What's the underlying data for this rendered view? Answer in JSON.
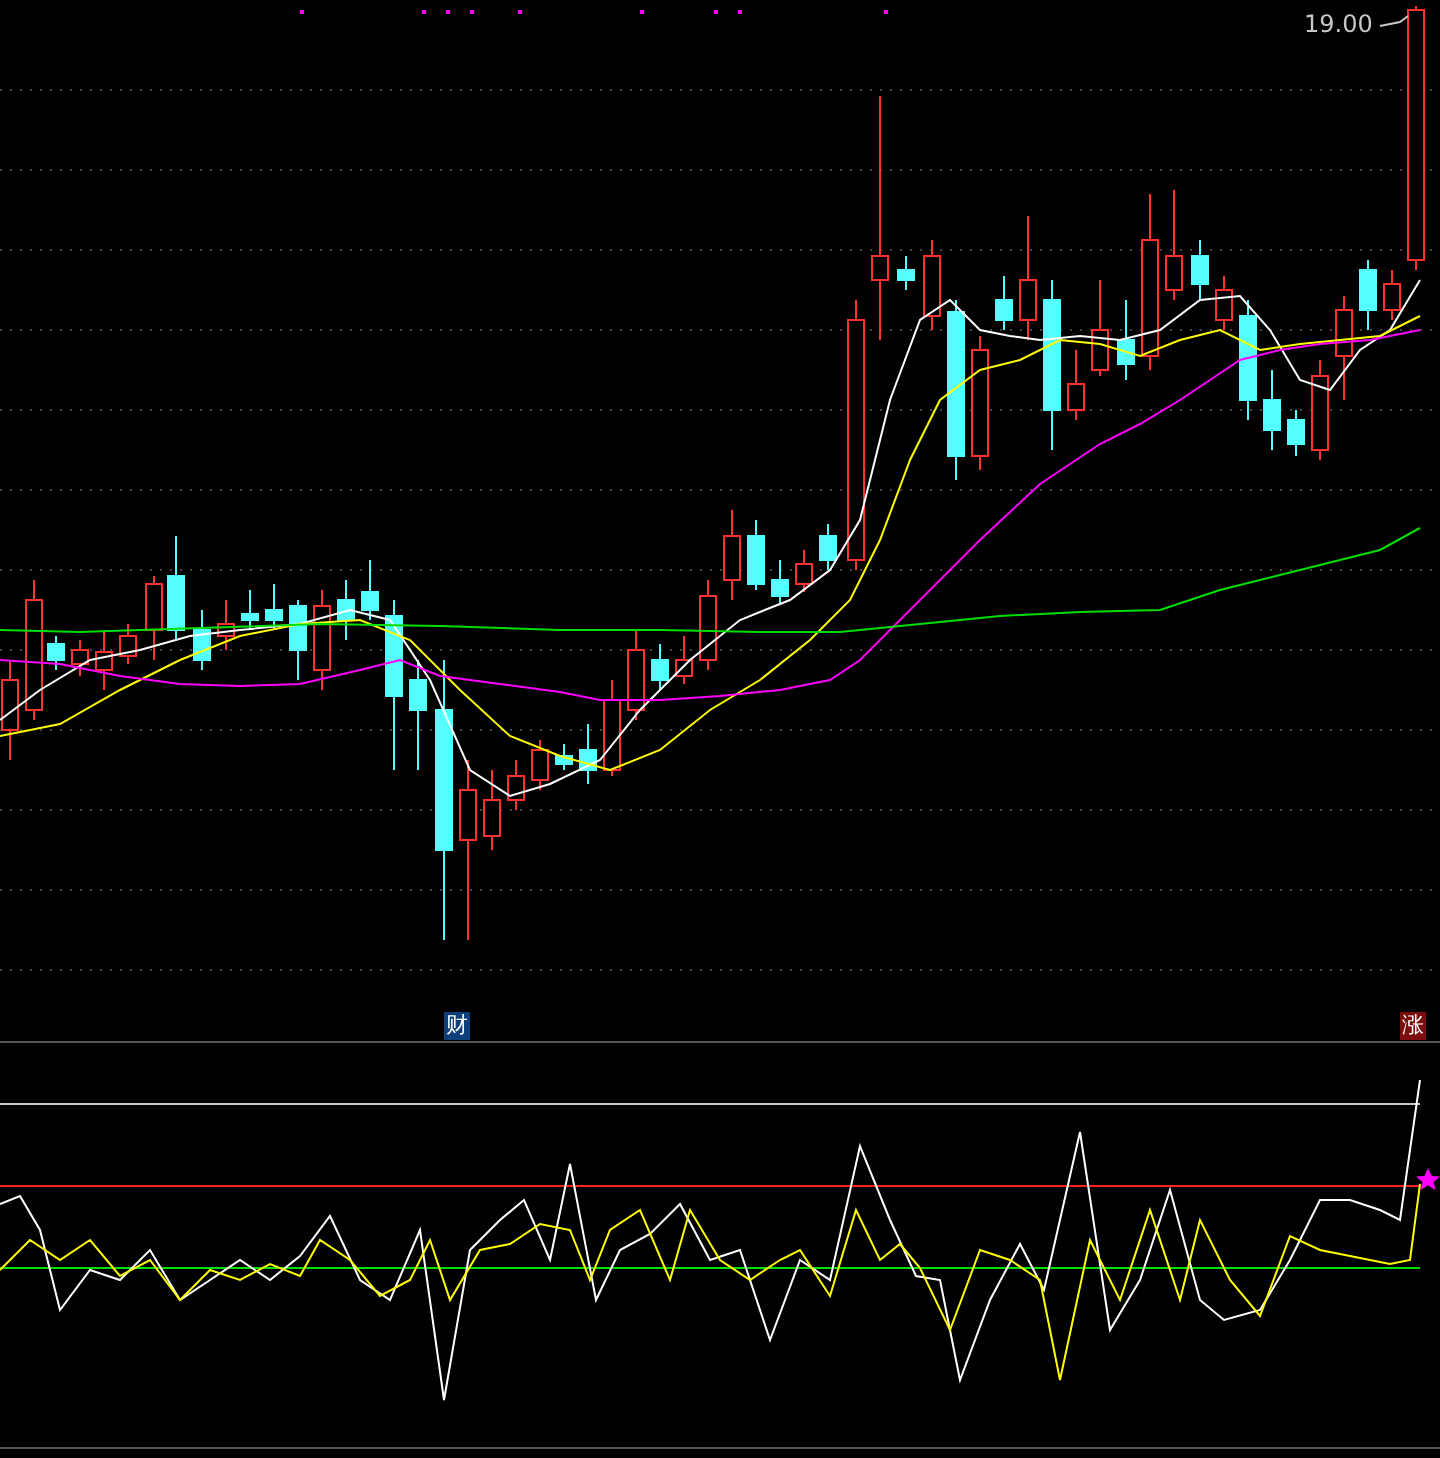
{
  "chart": {
    "price_label": "19.00",
    "markers": [
      {
        "text": "财",
        "color": "#0f3f7a"
      },
      {
        "text": "涨",
        "color": "#7a0d0d"
      }
    ]
  }
}
